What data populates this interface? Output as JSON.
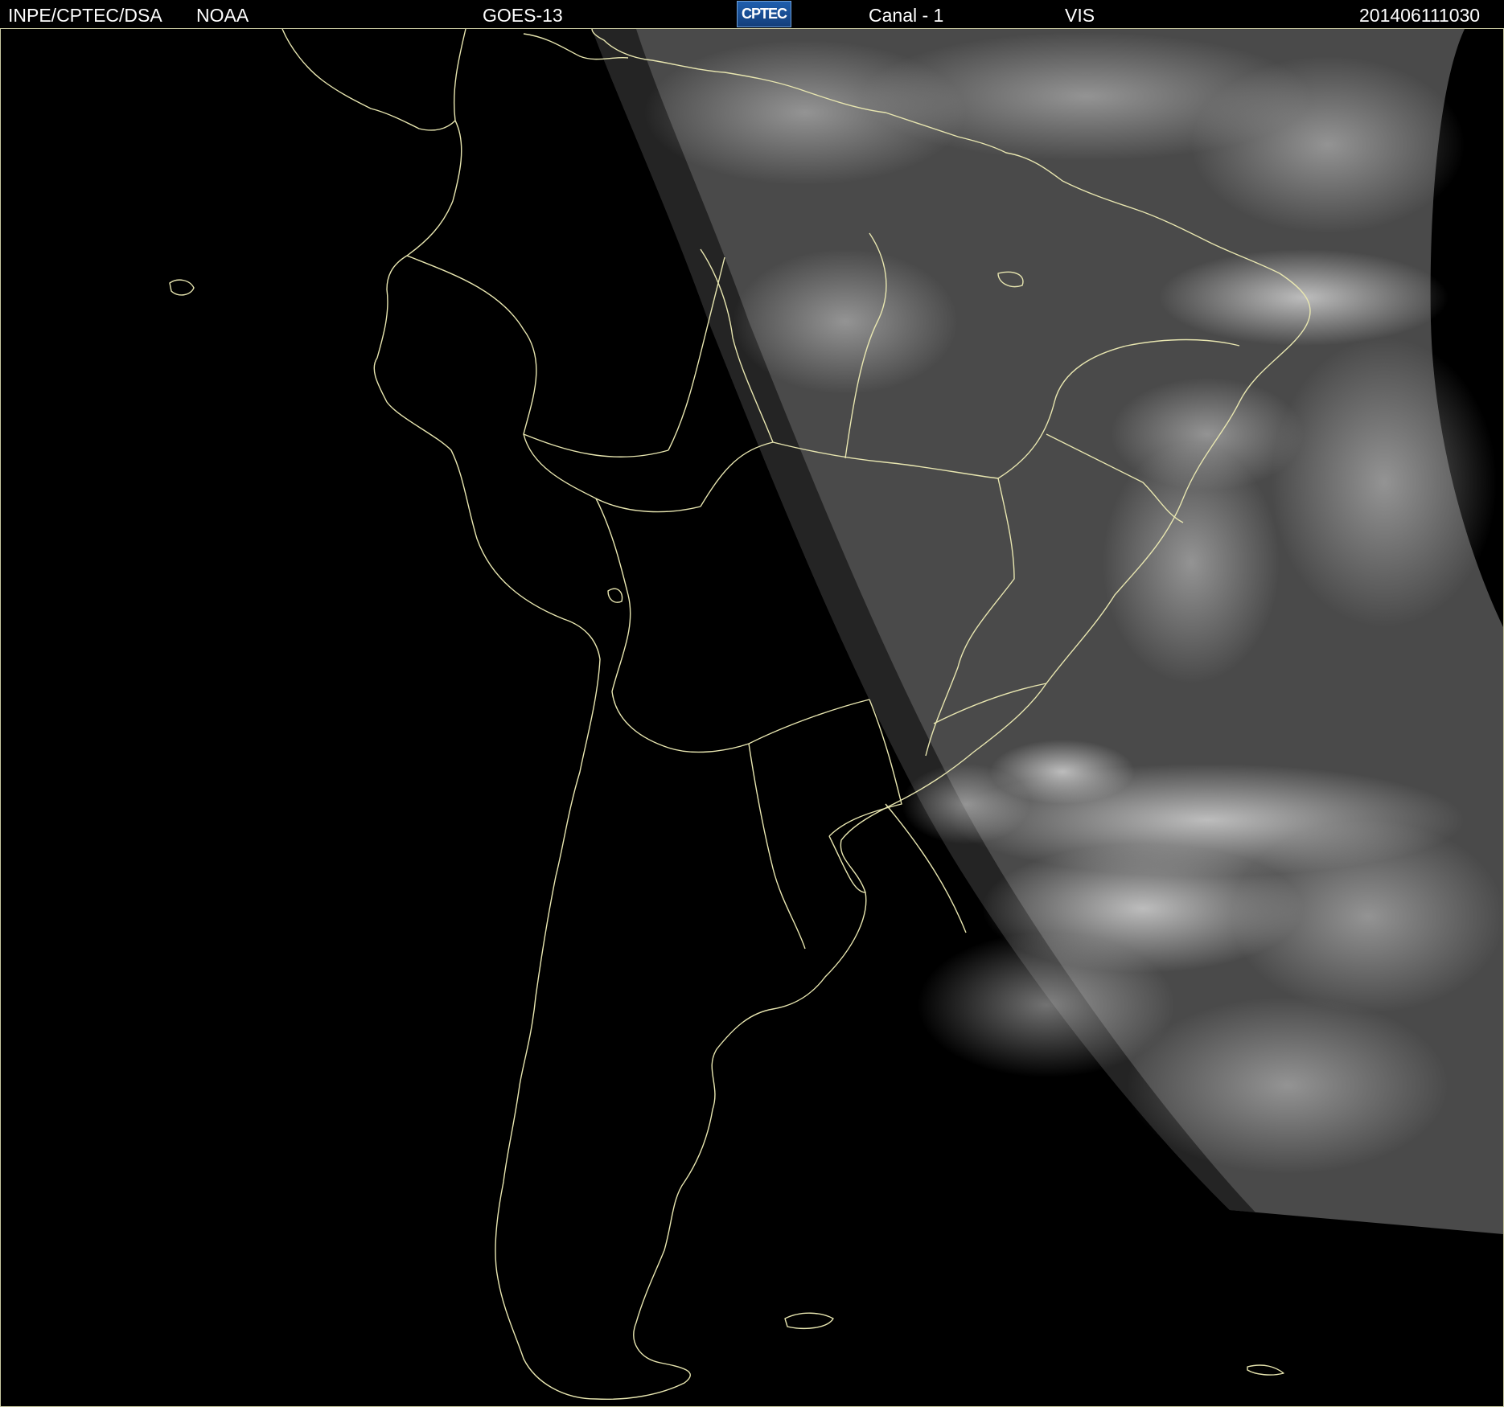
{
  "header": {
    "institution": "INPE/CPTEC/DSA",
    "agency": "NOAA",
    "satellite": "GOES-13",
    "logo_text": "CPTEC",
    "channel": "Canal - 1",
    "band": "VIS",
    "timestamp": "201406111030"
  },
  "map": {
    "region": "South America",
    "coastline_color": "#e8e6b0",
    "background_color": "#000000",
    "cloud_color": "#7a7a7a"
  }
}
